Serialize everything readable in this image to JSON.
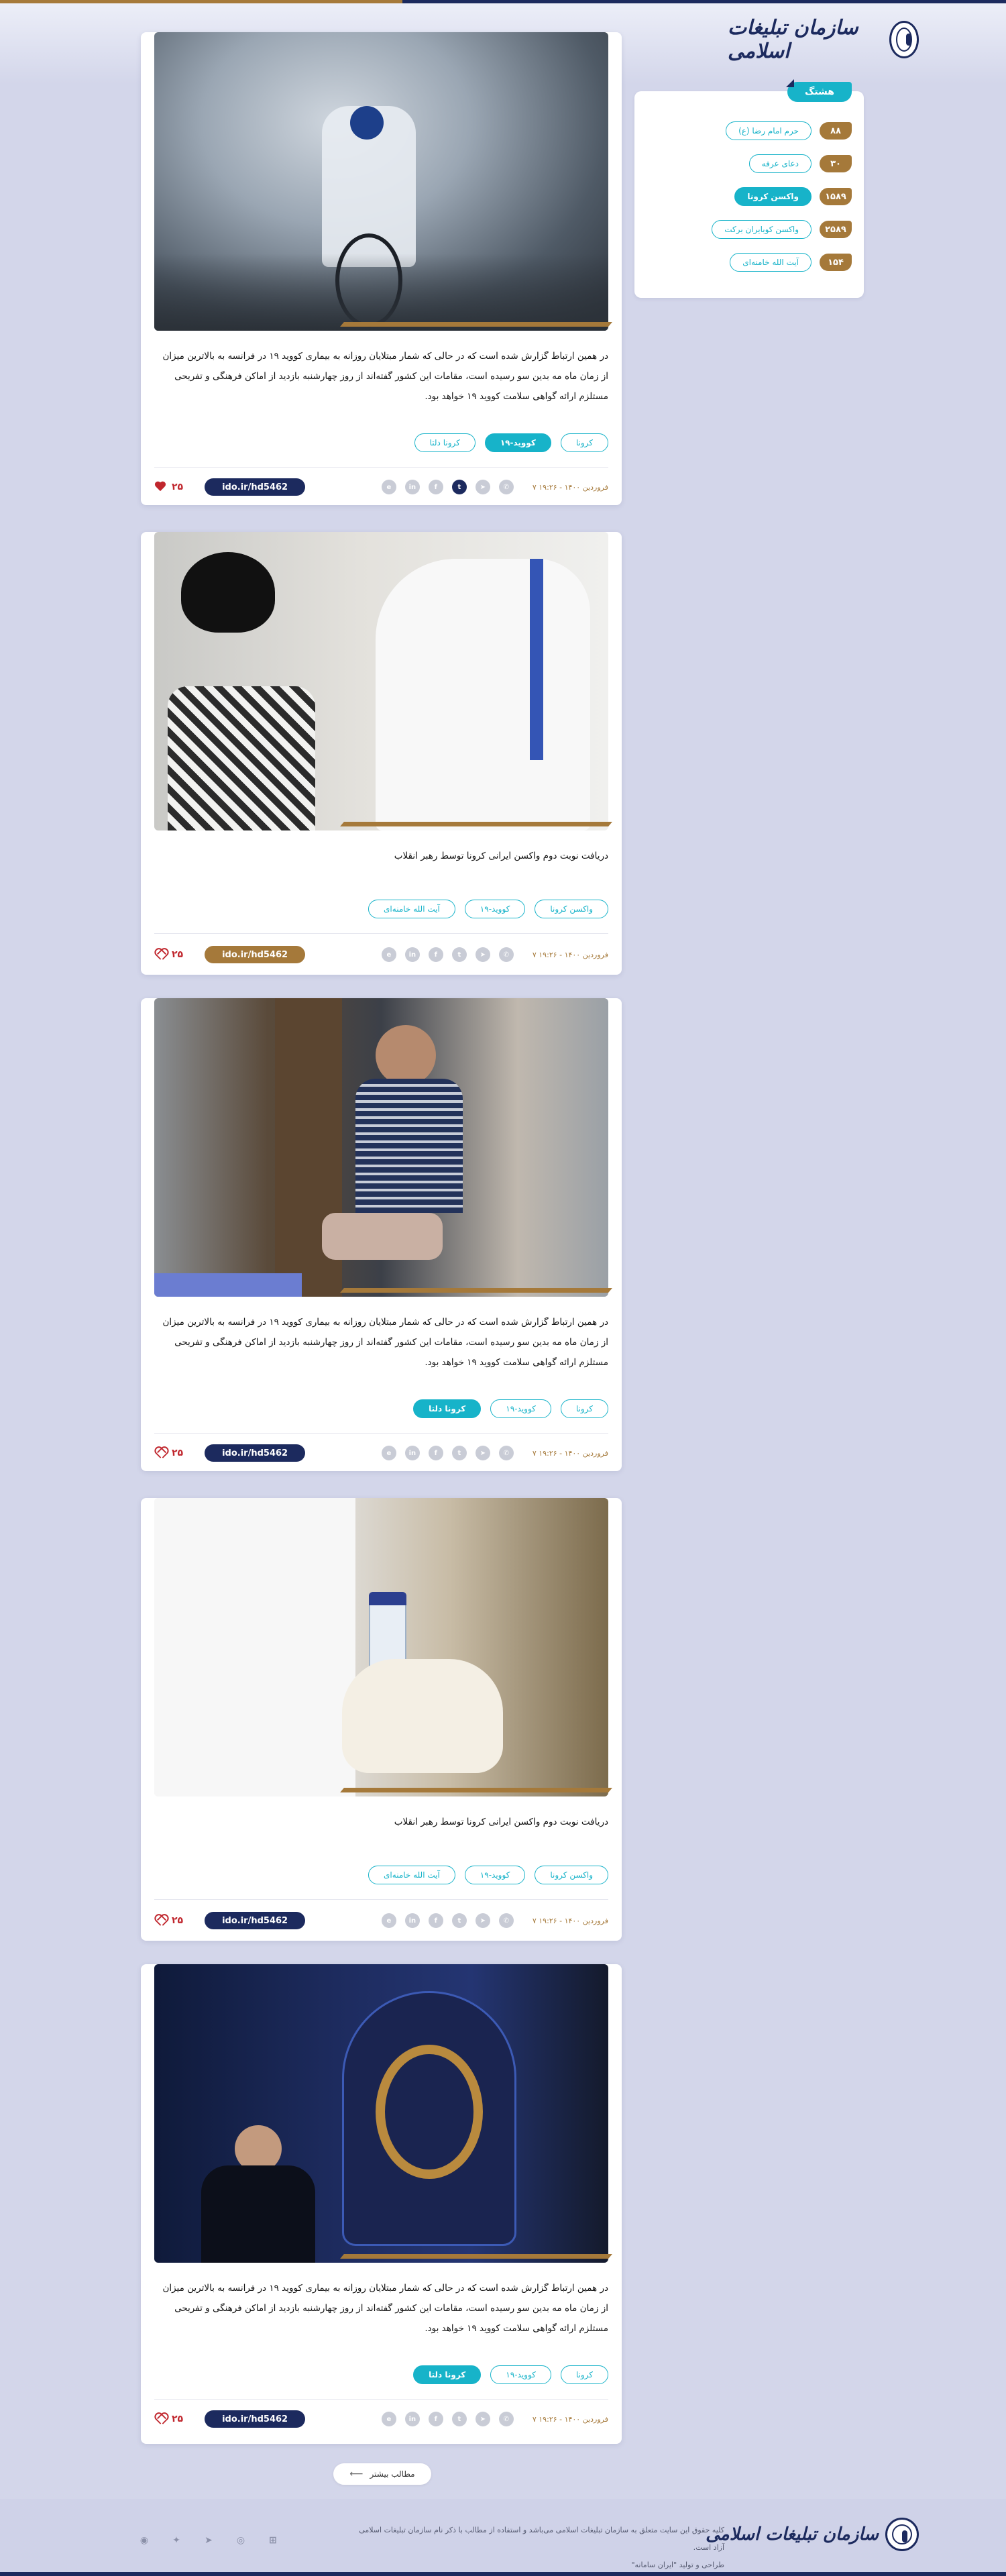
{
  "header": {
    "logo_text": "سازمان تبلیغات اسلامی"
  },
  "sidebar": {
    "title": "هشتگ",
    "tags": [
      {
        "label": "حرم امام رضا (ع)",
        "count": "۸۸",
        "active": false
      },
      {
        "label": "دعای عرفه",
        "count": "۳۰",
        "active": false
      },
      {
        "label": "واکسن کرونا",
        "count": "۱۵۸۹",
        "active": true
      },
      {
        "label": "واکسن کوبایران برکت",
        "count": "۲۵۸۹",
        "active": false
      },
      {
        "label": "آیت الله خامنه‌ای",
        "count": "۱۵۴",
        "active": false
      }
    ]
  },
  "cards": [
    {
      "image": "مردی در حال دوچرخه‌سواری کوهستان در میان گرد و غبار",
      "text": "در همین ارتباط گزارش شده است که در حالی که شمار مبتلایان روزانه به بیماری کووید ۱۹ در فرانسه به بالاترین میزان از زمان ماه مه بدین سو رسیده است، مقامات این کشور گفته‌اند از روز چهارشنبه بازدید از اماکن فرهنگی و تفریحی مستلزم ارائه گواهی سلامت کووید ۱۹ خواهد بود.",
      "tags": [
        {
          "label": "کرونا",
          "active": false
        },
        {
          "label": "کووید-۱۹",
          "active": true
        },
        {
          "label": "کرونا دلتا",
          "active": false
        }
      ],
      "date": "۷ فروردین ۱۴۰۰ - ۱۹:۲۶",
      "short_link": "ido.ir/hd5462",
      "likes": "۲۵",
      "liked": true
    },
    {
      "image": "دریافت واکسن توسط رهبر انقلاب",
      "text": "دریافت نوبت دوم واکسن ایرانی کرونا توسط رهبر انقلاب",
      "tags": [
        {
          "label": "واکسن کرونا",
          "active": false
        },
        {
          "label": "کووید-۱۹",
          "active": false
        },
        {
          "label": "آیت الله خامنه‌ای",
          "active": false
        }
      ],
      "date": "۷ فروردین ۱۴۰۰ - ۱۹:۲۶",
      "short_link": "ido.ir/hd5462",
      "likes": "۲۵",
      "liked": false
    },
    {
      "image": "کودکی در حال دریافت بسته گوشت",
      "text": "در همین ارتباط گزارش شده است که در حالی که شمار مبتلایان روزانه به بیماری کووید ۱۹ در فرانسه به بالاترین میزان از زمان ماه مه بدین سو رسیده است، مقامات این کشور گفته‌اند از روز چهارشنبه بازدید از اماکن فرهنگی و تفریحی مستلزم ارائه گواهی سلامت کووید ۱۹ خواهد بود.",
      "tags": [
        {
          "label": "کرونا",
          "active": false
        },
        {
          "label": "کووید-۱۹",
          "active": false
        },
        {
          "label": "کرونا دلتا",
          "active": true
        }
      ],
      "date": "۷ فروردین ۱۴۰۰ - ۱۹:۲۶",
      "short_link": "ido.ir/hd5462",
      "likes": "۲۵",
      "liked": false
    },
    {
      "image": "ویال واکسن کوو‌ایران برکت در دست",
      "text": "دریافت نوبت دوم واکسن ایرانی کرونا توسط رهبر انقلاب",
      "tags": [
        {
          "label": "واکسن کرونا",
          "active": false
        },
        {
          "label": "کووید-۱۹",
          "active": false
        },
        {
          "label": "آیت الله خامنه‌ای",
          "active": false
        }
      ],
      "date": "۷ فروردین ۱۴۰۰ - ۱۹:۲۶",
      "short_link": "ido.ir/hd5462",
      "likes": "۲۵",
      "liked": false
    },
    {
      "image": "مداح در حال مداحی در مراسم مذهبی",
      "text": "در همین ارتباط گزارش شده است که در حالی که شمار مبتلایان روزانه به بیماری کووید ۱۹ در فرانسه به بالاترین میزان از زمان ماه مه بدین سو رسیده است، مقامات این کشور گفته‌اند از روز چهارشنبه بازدید از اماکن فرهنگی و تفریحی مستلزم ارائه گواهی سلامت کووید ۱۹ خواهد بود.",
      "tags": [
        {
          "label": "کرونا",
          "active": false
        },
        {
          "label": "کووید-۱۹",
          "active": false
        },
        {
          "label": "کرونا دلتا",
          "active": true
        }
      ],
      "date": "۷ فروردین ۱۴۰۰ - ۱۹:۲۶",
      "short_link": "ido.ir/hd5462",
      "likes": "۲۵",
      "liked": false
    }
  ],
  "more_button": "مطالب بیشتر",
  "footer": {
    "copyright": "کلیه حقوق این سایت متعلق به سازمان تبلیغات اسلامی می‌باشد و استفاده از مطالب با ذکر نام سازمان تبلیغات اسلامی آزاد است.",
    "credit": "طراحی و تولید \"ایران سامانه\"",
    "logo_text": "سازمان تبلیغات اسلامی",
    "social_icons": [
      "rss-icon",
      "twitter-icon",
      "telegram-icon",
      "instagram-icon",
      "windows-icon"
    ]
  },
  "colors": {
    "accent": "#17b3c9",
    "gold": "#a5793a",
    "navy": "#1c2a5e",
    "like": "#c0262d",
    "background": "#d3d6ea"
  }
}
